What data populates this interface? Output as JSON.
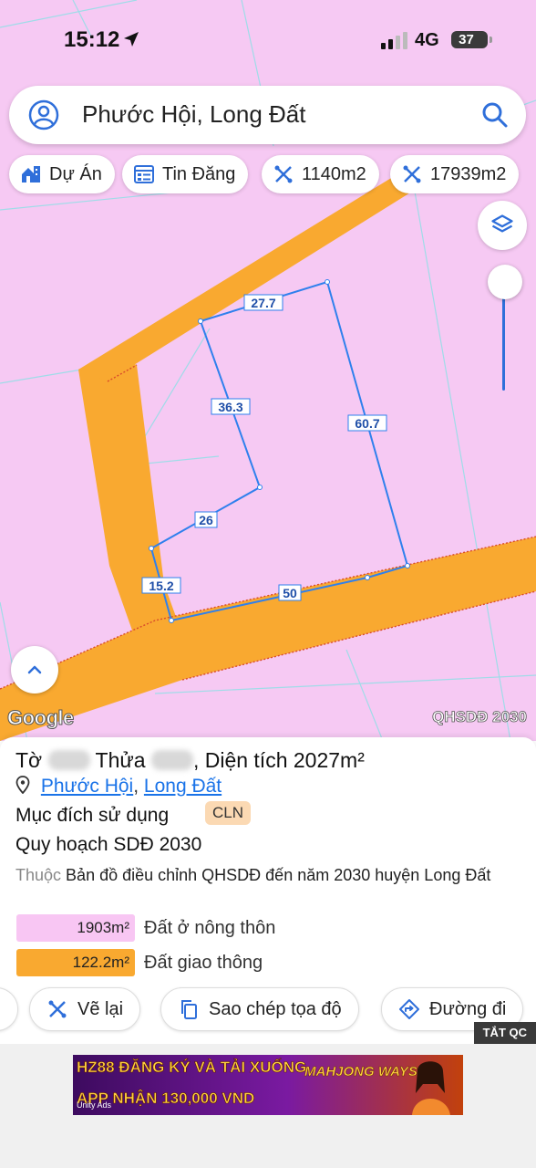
{
  "status_bar": {
    "time": "15:12",
    "network": "4G",
    "battery": "37"
  },
  "search": {
    "text": "Phước Hội, Long Đất"
  },
  "chips": [
    {
      "label": "Dự Án",
      "icon": "building-icon"
    },
    {
      "label": "Tin Đăng",
      "icon": "listing-icon"
    },
    {
      "label": "1140m2",
      "icon": "measure-icon"
    },
    {
      "label": "17939m2",
      "icon": "measure-icon"
    }
  ],
  "map": {
    "attribution": "Google",
    "layer_name": "QHSDĐ 2030",
    "edge_labels": [
      "27.7",
      "36.3",
      "60.7",
      "26",
      "15.2",
      "50"
    ],
    "colors": {
      "land": "#f6c9f3",
      "road": "#f9a930",
      "boundary": "#2f80ed"
    }
  },
  "parcel": {
    "title_prefix": "Tờ",
    "title_mid": "Thửa",
    "title_suffix": ", Diện tích 2027m²",
    "ward": "Phước Hội",
    "separator": ",",
    "district": "Long Đất",
    "usage_label": "Mục đích sử dụng",
    "usage_code": "CLN",
    "plan_title": "Quy hoạch SDĐ 2030",
    "plan_prefix": "Thuộc",
    "plan_text": "Bản đồ điều chỉnh QHSDĐ đến năm 2030 huyện Long Đất",
    "legend": [
      {
        "value": "1903m²",
        "label": "Đất ở nông thôn",
        "color": "#f8c6f3"
      },
      {
        "value": "122.2m²",
        "label": "Đất giao thông",
        "color": "#f9a930"
      }
    ]
  },
  "actions": [
    {
      "label": "Vẽ lại"
    },
    {
      "label": "Sao chép tọa độ"
    },
    {
      "label": "Đường đi"
    }
  ],
  "ad": {
    "close_label": "TẮT QC",
    "line1": "HZ88 ĐĂNG KÝ VÀ TẢI XUỐNG",
    "line2": "APP NHẬN 130,000 VND",
    "game": "MAHJONG WAYS 2",
    "network": "Unity Ads"
  }
}
